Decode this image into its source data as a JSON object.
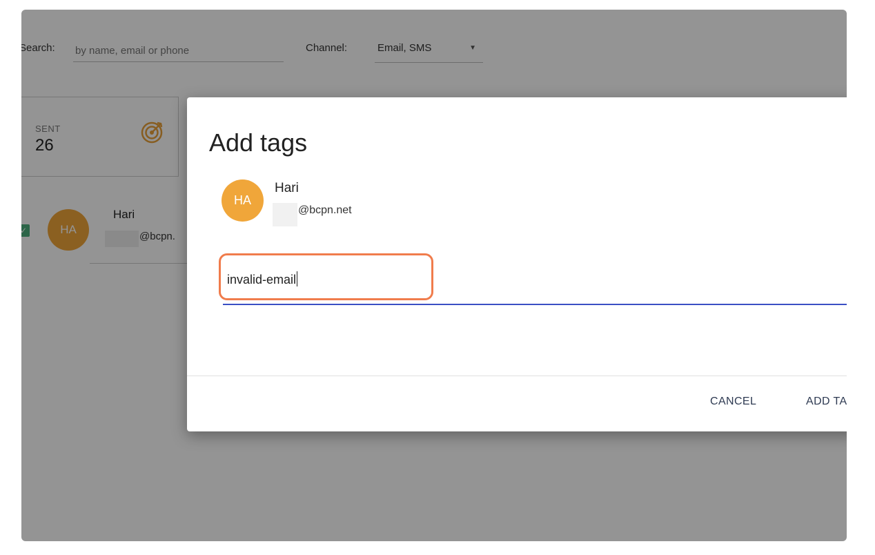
{
  "filters": {
    "search_label": "Search:",
    "search_placeholder": "by name, email or phone",
    "channel_label": "Channel:",
    "channel_value": "Email, SMS"
  },
  "stats": {
    "sent_label": "SENT",
    "sent_value": "26",
    "sent_icon": "target-icon"
  },
  "contact_row": {
    "initials": "HA",
    "name": "Hari",
    "email": "@bcpn."
  },
  "dialog": {
    "title": "Add tags",
    "contact_initials": "HA",
    "contact_name": "Hari",
    "contact_email": "@bcpn.net",
    "tag_input_value": "invalid-email",
    "cancel_label": "CANCEL",
    "add_label": "ADD TA"
  },
  "colors": {
    "avatar": "#f0a63a",
    "input_underline": "#3a4fc4",
    "highlight": "#f07c4c",
    "checkbox": "#4caf7d"
  }
}
